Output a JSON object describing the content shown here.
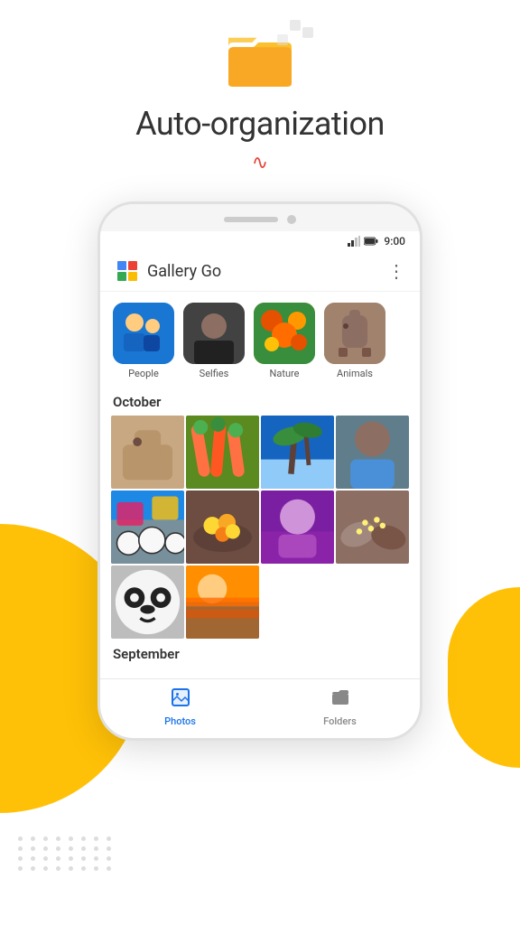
{
  "header": {
    "title": "Auto-organization",
    "title_decoration": "∿",
    "folder_icon": "folder",
    "mini_squares_icon": "mini-squares"
  },
  "phone": {
    "status_bar": {
      "time": "9:00",
      "battery_icon": "battery",
      "signal_icon": "signal"
    },
    "app_bar": {
      "title": "Gallery Go",
      "logo_icon": "gallery-go-logo",
      "more_icon": "⋮"
    },
    "albums": [
      {
        "label": "People",
        "color_class": "album-people"
      },
      {
        "label": "Selfies",
        "color_class": "album-selfies"
      },
      {
        "label": "Nature",
        "color_class": "album-nature"
      },
      {
        "label": "Animals",
        "color_class": "album-animals"
      }
    ],
    "sections": [
      {
        "label": "October",
        "photos": [
          {
            "color": "photo-horse"
          },
          {
            "color": "photo-veggies"
          },
          {
            "color": "photo-beach"
          },
          {
            "color": "photo-woman"
          },
          {
            "color": "photo-mural"
          },
          {
            "color": "photo-bowl"
          },
          {
            "color": "photo-purple"
          },
          {
            "color": "photo-hands"
          },
          {
            "color": "photo-panda"
          },
          {
            "color": "photo-orange"
          }
        ]
      },
      {
        "label": "September",
        "photos": []
      }
    ],
    "bottom_nav": [
      {
        "label": "Photos",
        "icon": "photos-icon",
        "active": true
      },
      {
        "label": "Folders",
        "icon": "folders-icon",
        "active": false
      }
    ]
  },
  "bg": {
    "yellow_color": "#FFC107",
    "dot_color": "#e0e0e0"
  }
}
